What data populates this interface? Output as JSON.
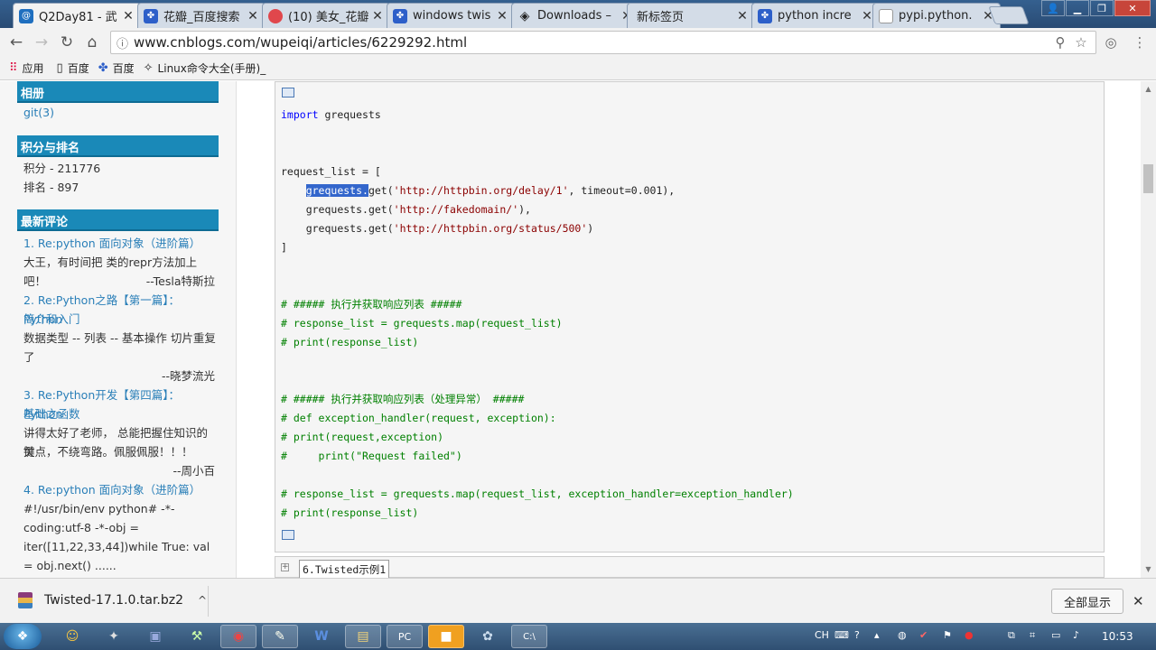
{
  "browser": {
    "tabs": [
      {
        "title": "Q2Day81 - 武",
        "icon": "cnblogs-icon",
        "active": true
      },
      {
        "title": "花瓣_百度搜索",
        "icon": "baidu-paw-icon"
      },
      {
        "title": "(10) 美女_花瓣",
        "icon": "huaban-icon"
      },
      {
        "title": "windows twis",
        "icon": "baidu-paw-icon"
      },
      {
        "title": "Downloads – ",
        "icon": "pypi-diamond-icon"
      },
      {
        "title": "新标签页",
        "icon": ""
      },
      {
        "title": "python incre",
        "icon": "baidu-paw-icon"
      },
      {
        "title": "pypi.python.",
        "icon": "file-icon"
      }
    ],
    "url": "www.cnblogs.com/wupeiqi/articles/6229292.html",
    "bookmarks": [
      {
        "label": "应用",
        "icon": "apps-grid-icon"
      },
      {
        "label": "百度",
        "icon": "page-icon"
      },
      {
        "label": "百度",
        "icon": "baidu-paw-icon"
      },
      {
        "label": "Linux命令大全(手册)_",
        "icon": "linux-icon"
      }
    ]
  },
  "sidebar": {
    "album_title": "相册",
    "album_item": "git(3)",
    "score_title": "积分与排名",
    "score": "积分 - 211776",
    "rank": "排名 - 897",
    "comments_title": "最新评论",
    "comments": [
      {
        "title_lines": [
          "1. Re:python 面向对象（进阶篇）"
        ],
        "body_lines": [
          "大王，有时间把 类的repr方法加上吧！"
        ],
        "author": "--Tesla特斯拉"
      },
      {
        "title_lines": [
          "2. Re:Python之路【第一篇】：Python",
          "简介和入门"
        ],
        "body_lines": [
          "数据类型 -- 列表 -- 基本操作  切片重复",
          "了"
        ],
        "author": "--晓梦流光"
      },
      {
        "title_lines": [
          "3. Re:Python开发【第四篇】：Python",
          "基础之函数"
        ],
        "body_lines": [
          "讲得太好了老师， 总能把握住知识的关",
          "键点，不绕弯路。佩服佩服！！！"
        ],
        "author": "--周小百"
      },
      {
        "title_lines": [
          "4. Re:python 面向对象（进阶篇）"
        ],
        "body_lines": [
          "#!/usr/bin/env python# -*-",
          "coding:utf-8 -*-obj =",
          "iter([11,22,33,44])while True: val",
          "= obj.next() ......"
        ],
        "author": ""
      }
    ]
  },
  "code": {
    "line_import_kw": "import",
    "line_import_rest": " grequests",
    "line_req_list": "request_list = [",
    "line_req1_sel": "grequests.",
    "line_req1_a": "get(",
    "line_req1_str": "'http://httpbin.org/delay/1'",
    "line_req1_b": ", timeout=0.001),",
    "line_req2_a": "grequests.get(",
    "line_req2_str": "'http://fakedomain/'",
    "line_req2_b": "),",
    "line_req3_a": "grequests.get(",
    "line_req3_str": "'http://httpbin.org/status/500'",
    "line_req3_b": ")",
    "line_close": "]",
    "c1": "# ##### 执行并获取响应列表 #####",
    "c2": "# response_list = grequests.map(request_list)",
    "c3": "# print(response_list)",
    "c4": "# ##### 执行并获取响应列表（处理异常） #####",
    "c5": "# def exception_handler(request, exception):",
    "c6": "# print(request,exception)",
    "c7": "#     print(\"Request failed\")",
    "c8": "# response_list = grequests.map(request_list, exception_handler=exception_handler)",
    "c9": "# print(response_list)",
    "collapsed_label": "6.Twisted示例1"
  },
  "download": {
    "filename": "Twisted-17.1.0.tar.bz2",
    "show_all": "全部显示"
  },
  "taskbar": {
    "lang": "CH",
    "time": "10:53"
  },
  "colors": {
    "sidebar_header": "#1a89b8",
    "keyword": "#0000ff",
    "string": "#8b0000",
    "comment": "#008000",
    "selection": "#3366cc"
  }
}
